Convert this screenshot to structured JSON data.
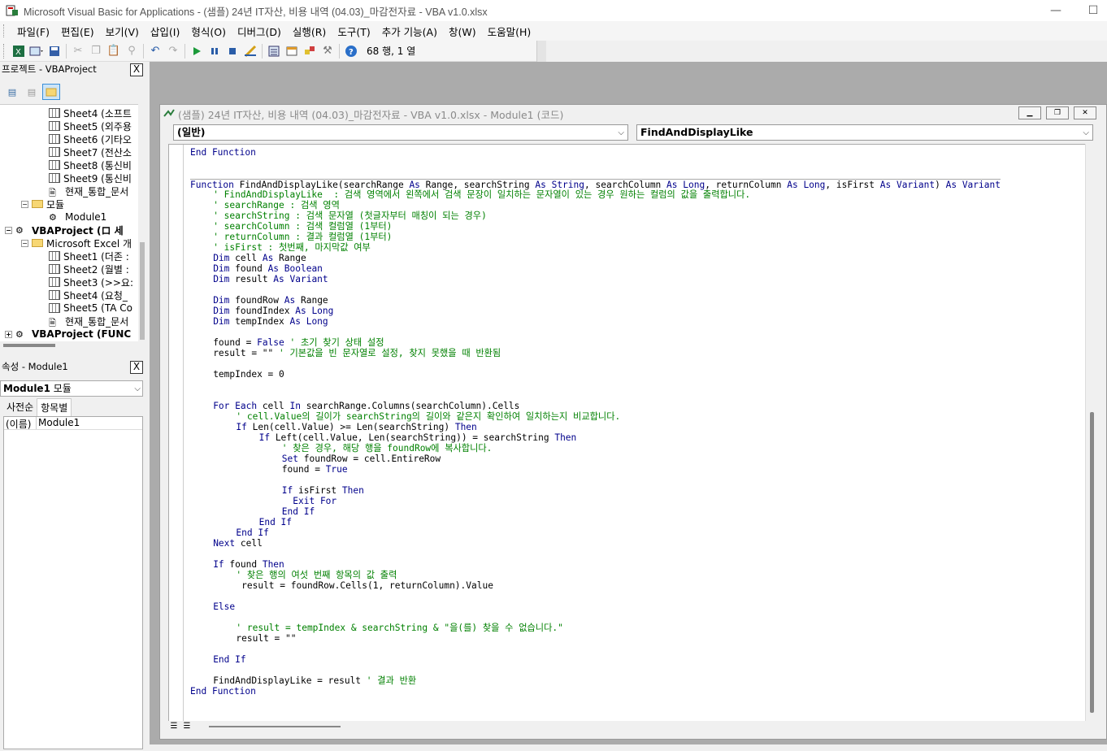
{
  "window": {
    "title": "Microsoft Visual Basic for Applications - (샘플) 24년 IT자산, 비용 내역 (04.03)_마감전자료 - VBA v1.0.xlsx",
    "minimize": "—",
    "maximize": "☐"
  },
  "menu": [
    "파일(F)",
    "편집(E)",
    "보기(V)",
    "삽입(I)",
    "형식(O)",
    "디버그(D)",
    "실행(R)",
    "도구(T)",
    "추가 기능(A)",
    "창(W)",
    "도움말(H)"
  ],
  "toolbar": {
    "position": "68 행, 1 열",
    "icons": [
      "excel-icon",
      "insert-userform-icon",
      "save-icon",
      "cut-icon",
      "copy-icon",
      "paste-icon",
      "find-icon",
      "undo-icon",
      "redo-icon",
      "run-icon",
      "break-icon",
      "reset-icon",
      "design-mode-icon",
      "project-explorer-icon",
      "properties-icon",
      "object-browser-icon",
      "toolbox-icon",
      "help-icon"
    ]
  },
  "project_panel": {
    "title": "프로젝트 - VBAProject",
    "close": "X",
    "items": [
      {
        "label": "Sheet4 (소프트",
        "type": "sheet"
      },
      {
        "label": "Sheet5 (외주용",
        "type": "sheet"
      },
      {
        "label": "Sheet6 (기타오",
        "type": "sheet"
      },
      {
        "label": "Sheet7 (전산소",
        "type": "sheet"
      },
      {
        "label": "Sheet8 (통신비",
        "type": "sheet"
      },
      {
        "label": "Sheet9 (통신비",
        "type": "sheet"
      },
      {
        "label": "현재_통합_문서",
        "type": "workbook"
      },
      {
        "label": "모듈",
        "type": "folder"
      },
      {
        "label": "Module1",
        "type": "module"
      },
      {
        "label": "VBAProject (ロ 세",
        "type": "project"
      },
      {
        "label": "Microsoft Excel 개",
        "type": "folder"
      },
      {
        "label": "Sheet1 (더존 :",
        "type": "sheet"
      },
      {
        "label": "Sheet2 (월별 :",
        "type": "sheet"
      },
      {
        "label": "Sheet3 (>>요:",
        "type": "sheet"
      },
      {
        "label": "Sheet4 (요청_",
        "type": "sheet"
      },
      {
        "label": "Sheet5 (TA Co",
        "type": "sheet"
      },
      {
        "label": "현재_통합_문서",
        "type": "workbook"
      },
      {
        "label": "VBAProject (FUNC",
        "type": "project"
      }
    ]
  },
  "props_panel": {
    "title": "속성 - Module1",
    "close": "X",
    "object_name": "Module1",
    "object_type": "모듈",
    "tabs": [
      "사전순",
      "항목별"
    ],
    "rows": [
      {
        "key": "(이름)",
        "value": "Module1"
      }
    ]
  },
  "code_window": {
    "title": "(샘플) 24년 IT자산, 비용 내역 (04.03)_마감전자료 - VBA v1.0.xlsx - Module1 (코드)",
    "object_combo": "(일반)",
    "proc_combo": "FindAndDisplayLike",
    "lines": [
      {
        "indent": 0,
        "parts": [
          {
            "c": "kw",
            "t": "End Function"
          }
        ]
      },
      {
        "indent": 0,
        "parts": []
      },
      {
        "indent": 0,
        "parts": []
      },
      {
        "indent": 0,
        "parts": [
          {
            "c": "kw",
            "t": "Function "
          },
          {
            "c": "pl",
            "t": "FindAndDisplayLike(searchRange "
          },
          {
            "c": "kw",
            "t": "As "
          },
          {
            "c": "pl",
            "t": "Range, searchString "
          },
          {
            "c": "kw",
            "t": "As String"
          },
          {
            "c": "pl",
            "t": ", searchColumn "
          },
          {
            "c": "kw",
            "t": "As Long"
          },
          {
            "c": "pl",
            "t": ", returnColumn "
          },
          {
            "c": "kw",
            "t": "As Long"
          },
          {
            "c": "pl",
            "t": ", isFirst "
          },
          {
            "c": "kw",
            "t": "As Variant"
          },
          {
            "c": "pl",
            "t": ") "
          },
          {
            "c": "kw",
            "t": "As Variant"
          }
        ]
      },
      {
        "indent": 1,
        "parts": [
          {
            "c": "cm",
            "t": "' FindAndDisplayLike  : 검색 영역에서 왼쪽에서 검색 문장이 일치하는 문자열이 있는 경우 원하는 컬럼의 값을 출력합니다."
          }
        ]
      },
      {
        "indent": 1,
        "parts": [
          {
            "c": "cm",
            "t": "' searchRange : 검색 영역"
          }
        ]
      },
      {
        "indent": 1,
        "parts": [
          {
            "c": "cm",
            "t": "' searchString : 검색 문자열 (첫글자부터 매칭이 되는 경우)"
          }
        ]
      },
      {
        "indent": 1,
        "parts": [
          {
            "c": "cm",
            "t": "' searchColumn : 검색 컬럼열 (1부터)"
          }
        ]
      },
      {
        "indent": 1,
        "parts": [
          {
            "c": "cm",
            "t": "' returnColumn : 결과 컬럼열 (1부터)"
          }
        ]
      },
      {
        "indent": 1,
        "parts": [
          {
            "c": "cm",
            "t": "' isFirst : 첫번째, 마지막값 여부"
          }
        ]
      },
      {
        "indent": 1,
        "parts": [
          {
            "c": "kw",
            "t": "Dim "
          },
          {
            "c": "pl",
            "t": "cell "
          },
          {
            "c": "kw",
            "t": "As "
          },
          {
            "c": "pl",
            "t": "Range"
          }
        ]
      },
      {
        "indent": 1,
        "parts": [
          {
            "c": "kw",
            "t": "Dim "
          },
          {
            "c": "pl",
            "t": "found "
          },
          {
            "c": "kw",
            "t": "As Boolean"
          }
        ]
      },
      {
        "indent": 1,
        "parts": [
          {
            "c": "kw",
            "t": "Dim "
          },
          {
            "c": "pl",
            "t": "result "
          },
          {
            "c": "kw",
            "t": "As Variant"
          }
        ]
      },
      {
        "indent": 0,
        "parts": []
      },
      {
        "indent": 1,
        "parts": [
          {
            "c": "kw",
            "t": "Dim "
          },
          {
            "c": "pl",
            "t": "foundRow "
          },
          {
            "c": "kw",
            "t": "As "
          },
          {
            "c": "pl",
            "t": "Range"
          }
        ]
      },
      {
        "indent": 1,
        "parts": [
          {
            "c": "kw",
            "t": "Dim "
          },
          {
            "c": "pl",
            "t": "foundIndex "
          },
          {
            "c": "kw",
            "t": "As Long"
          }
        ]
      },
      {
        "indent": 1,
        "parts": [
          {
            "c": "kw",
            "t": "Dim "
          },
          {
            "c": "pl",
            "t": "tempIndex "
          },
          {
            "c": "kw",
            "t": "As Long"
          }
        ]
      },
      {
        "indent": 0,
        "parts": []
      },
      {
        "indent": 1,
        "parts": [
          {
            "c": "pl",
            "t": "found = "
          },
          {
            "c": "kw",
            "t": "False "
          },
          {
            "c": "cm",
            "t": "' 초기 찾기 상태 설정"
          }
        ]
      },
      {
        "indent": 1,
        "parts": [
          {
            "c": "pl",
            "t": "result = \"\" "
          },
          {
            "c": "cm",
            "t": "' 기본값을 빈 문자열로 설정, 찾지 못했을 때 반환됨"
          }
        ]
      },
      {
        "indent": 0,
        "parts": []
      },
      {
        "indent": 1,
        "parts": [
          {
            "c": "pl",
            "t": "tempIndex = 0"
          }
        ]
      },
      {
        "indent": 0,
        "parts": []
      },
      {
        "indent": 0,
        "parts": []
      },
      {
        "indent": 1,
        "parts": [
          {
            "c": "kw",
            "t": "For Each "
          },
          {
            "c": "pl",
            "t": "cell "
          },
          {
            "c": "kw",
            "t": "In "
          },
          {
            "c": "pl",
            "t": "searchRange.Columns(searchColumn).Cells"
          }
        ]
      },
      {
        "indent": 2,
        "parts": [
          {
            "c": "cm",
            "t": "' cell.Value의 길이가 searchString의 길이와 같은지 확인하여 일치하는지 비교합니다."
          }
        ]
      },
      {
        "indent": 2,
        "parts": [
          {
            "c": "kw",
            "t": "If "
          },
          {
            "c": "pl",
            "t": "Len(cell.Value) >= Len(searchString) "
          },
          {
            "c": "kw",
            "t": "Then"
          }
        ]
      },
      {
        "indent": 3,
        "parts": [
          {
            "c": "kw",
            "t": "If "
          },
          {
            "c": "pl",
            "t": "Left(cell.Value, Len(searchString)) = searchString "
          },
          {
            "c": "kw",
            "t": "Then"
          }
        ]
      },
      {
        "indent": 4,
        "parts": [
          {
            "c": "cm",
            "t": "' 찾은 경우, 해당 행을 foundRow에 복사합니다."
          }
        ]
      },
      {
        "indent": 4,
        "parts": [
          {
            "c": "kw",
            "t": "Set "
          },
          {
            "c": "pl",
            "t": "foundRow = cell.EntireRow"
          }
        ]
      },
      {
        "indent": 4,
        "parts": [
          {
            "c": "pl",
            "t": "found = "
          },
          {
            "c": "kw",
            "t": "True"
          }
        ]
      },
      {
        "indent": 0,
        "parts": []
      },
      {
        "indent": 4,
        "parts": [
          {
            "c": "kw",
            "t": "If "
          },
          {
            "c": "pl",
            "t": "isFirst "
          },
          {
            "c": "kw",
            "t": "Then"
          }
        ]
      },
      {
        "indent": 4,
        "parts": [
          {
            "c": "kw",
            "t": "  Exit For"
          }
        ]
      },
      {
        "indent": 4,
        "parts": [
          {
            "c": "kw",
            "t": "End If"
          }
        ]
      },
      {
        "indent": 3,
        "parts": [
          {
            "c": "kw",
            "t": "End If"
          }
        ]
      },
      {
        "indent": 2,
        "parts": [
          {
            "c": "kw",
            "t": "End If"
          }
        ]
      },
      {
        "indent": 1,
        "parts": [
          {
            "c": "kw",
            "t": "Next "
          },
          {
            "c": "pl",
            "t": "cell"
          }
        ]
      },
      {
        "indent": 0,
        "parts": []
      },
      {
        "indent": 1,
        "parts": [
          {
            "c": "kw",
            "t": "If "
          },
          {
            "c": "pl",
            "t": "found "
          },
          {
            "c": "kw",
            "t": "Then"
          }
        ]
      },
      {
        "indent": 2,
        "parts": [
          {
            "c": "cm",
            "t": "' 찾은 행의 여섯 번째 항목의 값 출력"
          }
        ]
      },
      {
        "indent": 2,
        "parts": [
          {
            "c": "pl",
            "t": " result = foundRow.Cells(1, returnColumn).Value"
          }
        ]
      },
      {
        "indent": 0,
        "parts": []
      },
      {
        "indent": 1,
        "parts": [
          {
            "c": "kw",
            "t": "Else"
          }
        ]
      },
      {
        "indent": 0,
        "parts": []
      },
      {
        "indent": 2,
        "parts": [
          {
            "c": "cm",
            "t": "' result = tempIndex & searchString & \"을(를) 찾을 수 없습니다.\""
          }
        ]
      },
      {
        "indent": 2,
        "parts": [
          {
            "c": "pl",
            "t": "result = \"\""
          }
        ]
      },
      {
        "indent": 0,
        "parts": []
      },
      {
        "indent": 1,
        "parts": [
          {
            "c": "kw",
            "t": "End If"
          }
        ]
      },
      {
        "indent": 0,
        "parts": []
      },
      {
        "indent": 1,
        "parts": [
          {
            "c": "pl",
            "t": "FindAndDisplayLike = result "
          },
          {
            "c": "cm",
            "t": "' 결과 반환"
          }
        ]
      },
      {
        "indent": 0,
        "parts": [
          {
            "c": "kw",
            "t": "End Function"
          }
        ]
      }
    ]
  }
}
